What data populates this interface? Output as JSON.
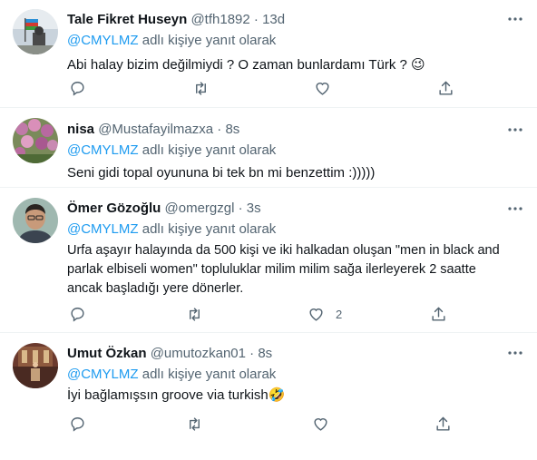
{
  "reply_prefix": "adlı kişiye yanıt olarak",
  "mention": "@CMYLMZ",
  "tweets": [
    {
      "name": "Tale Fikret Huseyn",
      "handle": "@tfh1892",
      "dot": "·",
      "time": "13d",
      "lines": [
        "Abi halay bizim değilmiydi ? O zaman bunlardamı Türk ? 😉"
      ],
      "likes": ""
    },
    {
      "name": "nisa",
      "handle": "@Mustafayilmazxa",
      "dot": "·",
      "time": "8s",
      "lines": [
        "Seni gidi topal oyununa bi tek bn mi benzettim :)))))"
      ],
      "likes": ""
    },
    {
      "name": "Ömer Gözoğlu",
      "handle": "@omergzgl",
      "dot": "·",
      "time": "3s",
      "lines": [
        "Urfa aşayır halayında da 500 kişi ve iki halkadan oluşan \"men in black and",
        "parlak elbiseli women\" topluluklar milim milim sağa ilerleyerek 2 saatte",
        "ancak başladığı yere dönerler."
      ],
      "likes": "2"
    },
    {
      "name": "Umut Özkan",
      "handle": "@umutozkan01",
      "dot": "·",
      "time": "8s",
      "lines": [
        "İyi bağlamışsın groove via turkish🤣"
      ],
      "likes": ""
    }
  ]
}
